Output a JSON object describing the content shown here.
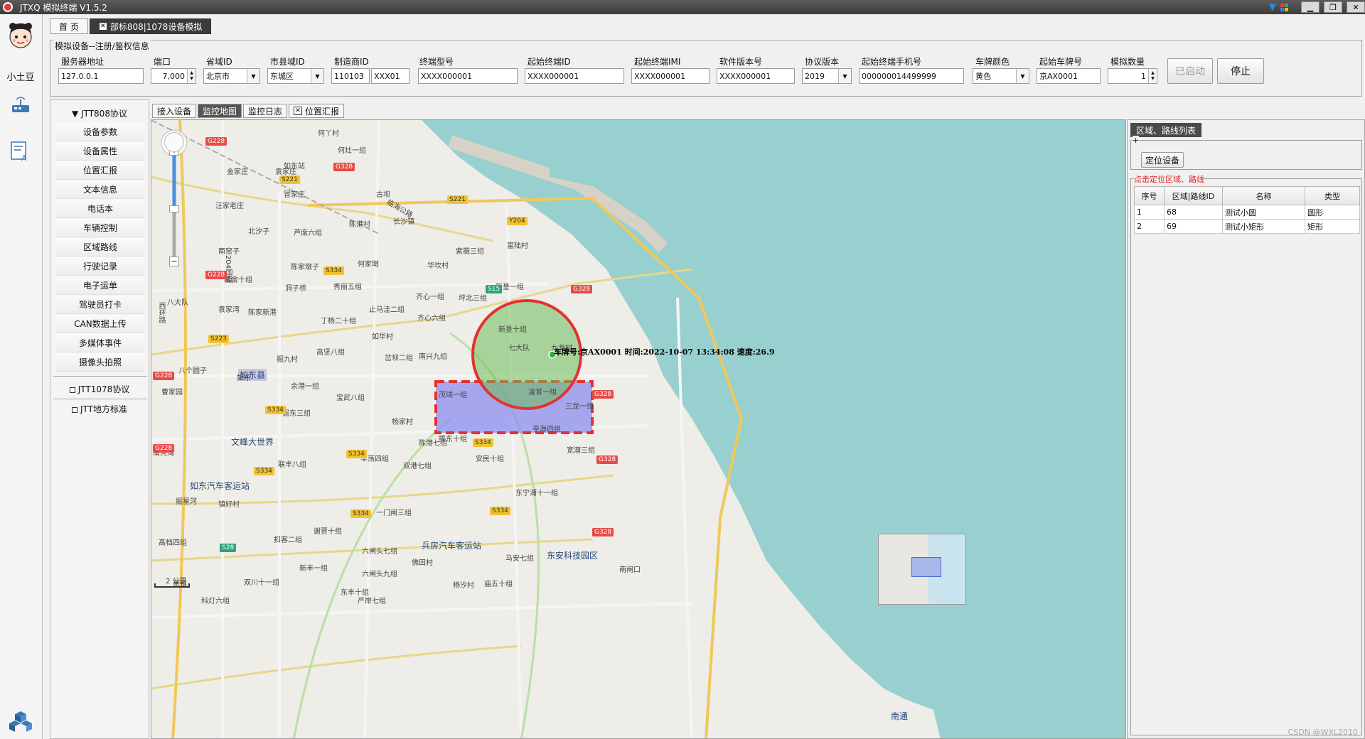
{
  "window": {
    "title": "JTXQ 模拟终端 V1.5.2"
  },
  "user": {
    "name": "小土豆"
  },
  "tabs": [
    {
      "label": "首 页",
      "closable": false
    },
    {
      "label": "部标808|1078设备模拟",
      "closable": true
    }
  ],
  "params": {
    "legend": "模拟设备--注册/鉴权信息",
    "fields": [
      {
        "label": "服务器地址",
        "value": "127.0.0.1"
      },
      {
        "label": "端口",
        "value": "7,000"
      },
      {
        "label": "省域ID",
        "value": "北京市"
      },
      {
        "label": "市县域ID",
        "value": "东城区"
      },
      {
        "label": "制造商ID",
        "value": "110103"
      },
      {
        "label": "",
        "value": "XXX01"
      },
      {
        "label": "终端型号",
        "value": "XXXX000001"
      },
      {
        "label": "起始终端ID",
        "value": "XXXX000001"
      },
      {
        "label": "起始终端IMI",
        "value": "XXXX000001"
      },
      {
        "label": "软件版本号",
        "value": "XXXX000001"
      },
      {
        "label": "协议版本",
        "value": "2019"
      },
      {
        "label": "起始终端手机号",
        "value": "000000014499999"
      },
      {
        "label": "车牌颜色",
        "value": "黄色"
      },
      {
        "label": "起始车牌号",
        "value": "京AX0001"
      },
      {
        "label": "模拟数量",
        "value": "1"
      }
    ],
    "started_label": "已启动",
    "stop_label": "停止"
  },
  "protocols": {
    "jtt808": "JTT808协议",
    "items": [
      "设备参数",
      "设备属性",
      "位置汇报",
      "文本信息",
      "电话本",
      "车辆控制",
      "区域路线",
      "行驶记录",
      "电子运单",
      "驾驶员打卡",
      "CAN数据上传",
      "多媒体事件",
      "摄像头拍照"
    ],
    "jtt1078": "JTT1078协议",
    "local": "JTT地方标准"
  },
  "subtabs": [
    "接入设备",
    "监控地图",
    "监控日志",
    "位置汇报"
  ],
  "map": {
    "vehicle_info": "车牌号:京AX0001 时间:2022-10-07 13:34:08 速度:26.9",
    "scale": "2 公里",
    "places": [
      "如东站",
      "何丫村",
      "何灶一组",
      "金家庄",
      "袁家庄",
      "冒家庄",
      "汪家老庄",
      "古坝",
      "长沙镇",
      "北汐子",
      "芦席六组",
      "陈港村",
      "南窑子",
      "陈家墩子",
      "何家墩",
      "戴舍十组",
      "洞子桥",
      "秀丽五组",
      "华坎村",
      "紫薇三组",
      "富陆村",
      "新垦一组",
      "齐心一组",
      "坪北三组",
      "齐心六组",
      "新垦十组",
      "七大队",
      "九龙村",
      "丁杨二十组",
      "止马洼二组",
      "如华村",
      "袁家湾",
      "陈家新港",
      "西环路",
      "八大队",
      "高坚八组",
      "掘九村",
      "岔坝二组",
      "南兴九组",
      "八个圆子",
      "曹家园",
      "如东县",
      "余港一组",
      "宝武八组",
      "茂瑞一组",
      "凌官一组",
      "三龙一组",
      "掘东三组",
      "文峰大世界",
      "杨家村",
      "捧东十组",
      "亭海四组",
      "南河湾",
      "联丰八组",
      "丰荡四组",
      "安民十组",
      "双港七组",
      "宽潜三组",
      "如东汽车客运站",
      "镇好村",
      "一门闸三组",
      "东宁浦十一组",
      "掘星河",
      "谢贾十组",
      "扣客二组",
      "兵房汽车客运站",
      "东安科技园区",
      "高档四组",
      "六闸头七组",
      "马安七组",
      "陈港七组",
      "佛田村",
      "新丰一组",
      "六闸头九组",
      "南闸口",
      "蕉镇",
      "双川十一组",
      "东丰十组",
      "杨汐村",
      "科灯六组",
      "严岸七组",
      "庙五十组",
      "南通",
      "临海公路",
      "204国道",
      "如东"
    ],
    "roads": [
      "G228",
      "G328",
      "S221",
      "S334",
      "Y204",
      "S15",
      "S223",
      "S28"
    ]
  },
  "region_panel": {
    "title": "区域、路线列表",
    "locate_button": "定位设备",
    "hint": "点击定位区域、路线",
    "columns": [
      "序号",
      "区域|路线ID",
      "名称",
      "类型"
    ],
    "rows": [
      [
        "1",
        "68",
        "测试小圆",
        "圆形"
      ],
      [
        "2",
        "69",
        "测试小矩形",
        "矩形"
      ]
    ]
  },
  "watermark": "CSDN @WXL2010"
}
